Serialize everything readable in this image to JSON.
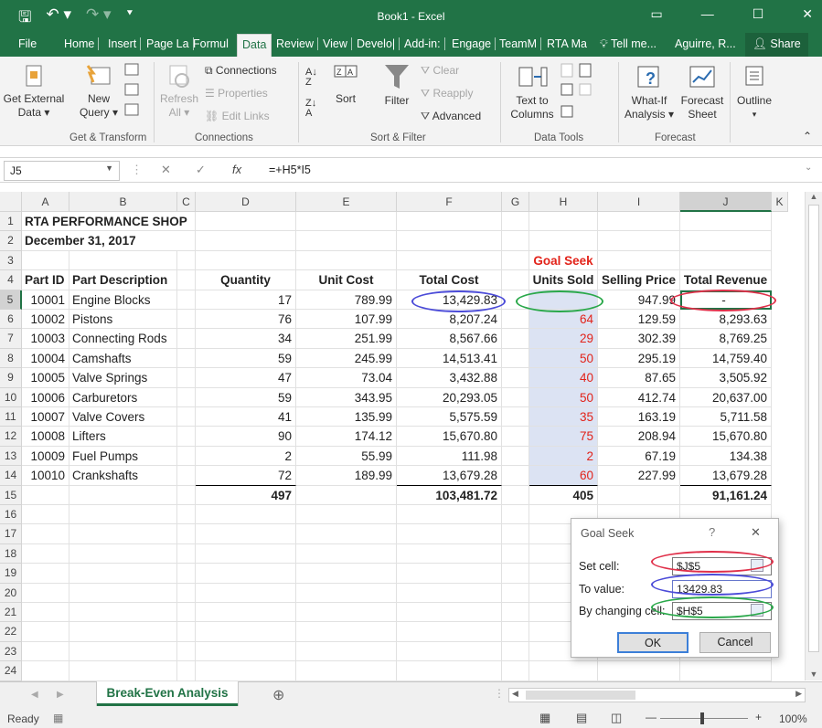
{
  "window": {
    "title": "Book1 - Excel",
    "user": "Aguirre, R...",
    "share": "Share"
  },
  "tabs": [
    "File",
    "Home",
    "Insert",
    "Page La",
    "Formul",
    "Data",
    "Review",
    "View",
    "Develo|",
    "Add-in:",
    "Engage",
    "TeamM",
    "RTA Ma",
    "Tell me..."
  ],
  "ribbon": {
    "get_external": "Get External\nData ▾",
    "new_query": "New\nQuery ▾",
    "refresh_all": "Refresh\nAll ▾",
    "connections": "Connections",
    "properties": "Properties",
    "edit_links": "Edit Links",
    "sort": "Sort",
    "filter": "Filter",
    "clear": "Clear",
    "reapply": "Reapply",
    "advanced": "Advanced",
    "text_to_columns": "Text to\nColumns",
    "what_if": "What-If\nAnalysis ▾",
    "forecast_sheet": "Forecast\nSheet",
    "outline": "Outline",
    "groups": {
      "get_transform": "Get & Transform",
      "connections": "Connections",
      "sort_filter": "Sort & Filter",
      "data_tools": "Data Tools",
      "forecast": "Forecast"
    }
  },
  "formula_bar": {
    "name_box": "J5",
    "formula": "=+H5*I5",
    "fx": "fx"
  },
  "columns": [
    "A",
    "B",
    "C",
    "D",
    "E",
    "F",
    "G",
    "H",
    "I",
    "J",
    "K"
  ],
  "rows": [
    "1",
    "2",
    "3",
    "4",
    "5",
    "6",
    "7",
    "8",
    "9",
    "10",
    "11",
    "12",
    "13",
    "14",
    "15",
    "16",
    "17",
    "18",
    "19",
    "20",
    "21",
    "22",
    "23",
    "24"
  ],
  "sheet": {
    "title": "RTA PERFORMANCE SHOP",
    "date": "December 31, 2017",
    "goal_seek_label": "Goal Seek",
    "headers": {
      "part_id": "Part ID",
      "desc": "Part Description",
      "qty": "Quantity",
      "unit_cost": "Unit Cost",
      "total_cost": "Total Cost",
      "units_sold": "Units Sold",
      "price": "Selling Price",
      "revenue": "Total Revenue"
    },
    "data_rows": [
      {
        "id": "10001",
        "desc": "Engine Blocks",
        "qty": "17",
        "unit_cost": "789.99",
        "total_cost": "13,429.83",
        "units_sold": "",
        "price": "947.99",
        "revenue": "-"
      },
      {
        "id": "10002",
        "desc": "Pistons",
        "qty": "76",
        "unit_cost": "107.99",
        "total_cost": "8,207.24",
        "units_sold": "64",
        "price": "129.59",
        "revenue": "8,293.63"
      },
      {
        "id": "10003",
        "desc": "Connecting Rods",
        "qty": "34",
        "unit_cost": "251.99",
        "total_cost": "8,567.66",
        "units_sold": "29",
        "price": "302.39",
        "revenue": "8,769.25"
      },
      {
        "id": "10004",
        "desc": "Camshafts",
        "qty": "59",
        "unit_cost": "245.99",
        "total_cost": "14,513.41",
        "units_sold": "50",
        "price": "295.19",
        "revenue": "14,759.40"
      },
      {
        "id": "10005",
        "desc": "Valve Springs",
        "qty": "47",
        "unit_cost": "73.04",
        "total_cost": "3,432.88",
        "units_sold": "40",
        "price": "87.65",
        "revenue": "3,505.92"
      },
      {
        "id": "10006",
        "desc": "Carburetors",
        "qty": "59",
        "unit_cost": "343.95",
        "total_cost": "20,293.05",
        "units_sold": "50",
        "price": "412.74",
        "revenue": "20,637.00"
      },
      {
        "id": "10007",
        "desc": "Valve Covers",
        "qty": "41",
        "unit_cost": "135.99",
        "total_cost": "5,575.59",
        "units_sold": "35",
        "price": "163.19",
        "revenue": "5,711.58"
      },
      {
        "id": "10008",
        "desc": "Lifters",
        "qty": "90",
        "unit_cost": "174.12",
        "total_cost": "15,670.80",
        "units_sold": "75",
        "price": "208.94",
        "revenue": "15,670.80"
      },
      {
        "id": "10009",
        "desc": "Fuel Pumps",
        "qty": "2",
        "unit_cost": "55.99",
        "total_cost": "111.98",
        "units_sold": "2",
        "price": "67.19",
        "revenue": "134.38"
      },
      {
        "id": "10010",
        "desc": "Crankshafts",
        "qty": "72",
        "unit_cost": "189.99",
        "total_cost": "13,679.28",
        "units_sold": "60",
        "price": "227.99",
        "revenue": "13,679.28"
      }
    ],
    "totals": {
      "qty": "497",
      "total_cost": "103,481.72",
      "units_sold": "405",
      "revenue": "91,161.24"
    }
  },
  "dialog": {
    "title": "Goal Seek",
    "help": "?",
    "close": "✕",
    "set_cell_label": "Set cell:",
    "set_cell_value": "$J$5",
    "to_value_label": "To value:",
    "to_value_value": "13429.83",
    "changing_label": "By changing cell:",
    "changing_value": "$H$5",
    "ok": "OK",
    "cancel": "Cancel"
  },
  "sheet_tab": "Break-Even Analysis",
  "status": {
    "ready": "Ready",
    "zoom": "100%"
  },
  "colors": {
    "excel_green": "#217346",
    "highlight_blue": "#dce3f3",
    "red": "#e2231a",
    "ellipse_blue": "#4b4bd8",
    "ellipse_green": "#2aa84a",
    "ellipse_red": "#e0304a"
  }
}
